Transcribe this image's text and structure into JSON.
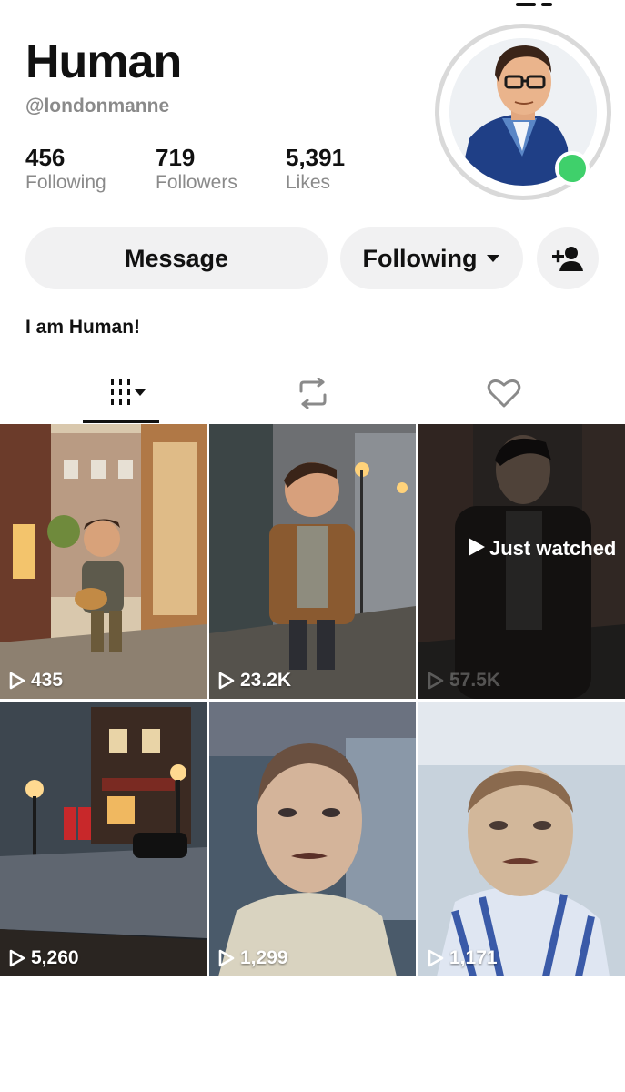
{
  "profile": {
    "name": "Human",
    "handle": "@londonmanne",
    "bio": "I am Human!",
    "online_color": "#3fd06b"
  },
  "stats": [
    {
      "value": "456",
      "label": "Following"
    },
    {
      "value": "719",
      "label": "Followers"
    },
    {
      "value": "5,391",
      "label": "Likes"
    }
  ],
  "actions": {
    "message_label": "Message",
    "following_label": "Following"
  },
  "tabs": [
    {
      "icon": "grid-dropdown-icon",
      "active": true
    },
    {
      "icon": "repost-icon",
      "active": false
    },
    {
      "icon": "heart-outline-icon",
      "active": false
    }
  ],
  "videos": [
    {
      "views": "435",
      "scene": "clay figure with guitar on cobbled street"
    },
    {
      "views": "23.2K",
      "scene": "clay figure in brown jacket on wet street"
    },
    {
      "views": "57.5K",
      "scene": "man in leather jacket",
      "overlay": "Just watched"
    },
    {
      "views": "5,260",
      "scene": "miniature pub diorama with phone boxes"
    },
    {
      "views": "1,299",
      "scene": "painted portrait of man"
    },
    {
      "views": "1,171",
      "scene": "painted portrait of man in striped shirt"
    }
  ],
  "colors": {
    "button_bg": "#f1f1f2",
    "muted_text": "#8a8a8a"
  }
}
